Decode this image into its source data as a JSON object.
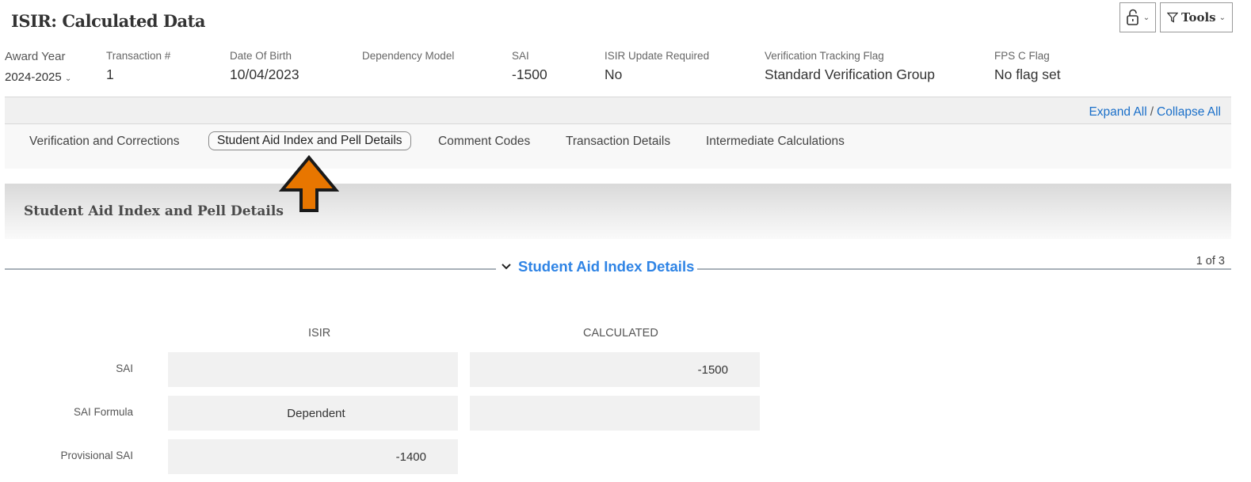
{
  "page": {
    "title": "ISIR: Calculated Data"
  },
  "toolbar": {
    "lock_icon": "unlock-icon",
    "tools_label": "Tools",
    "tools_icon": "filter-icon",
    "chevron": "⌄"
  },
  "summary": {
    "award_year": {
      "label": "Award Year",
      "value": "2024-2025"
    },
    "transaction": {
      "label": "Transaction #",
      "value": "1"
    },
    "dob": {
      "label": "Date Of Birth",
      "value": "10/04/2023"
    },
    "dependency_model": {
      "label": "Dependency Model",
      "value": ""
    },
    "sai": {
      "label": "SAI",
      "value": "-1500"
    },
    "isir_update": {
      "label": "ISIR Update Required",
      "value": "No"
    },
    "verification_flag": {
      "label": "Verification Tracking Flag",
      "value": "Standard Verification Group"
    },
    "fps_flag": {
      "label": "FPS C Flag",
      "value": "No flag set"
    }
  },
  "expand": {
    "expand_all": "Expand All",
    "separator": "/",
    "collapse_all": "Collapse All"
  },
  "tabs": [
    {
      "label": "Verification and Corrections",
      "active": false
    },
    {
      "label": "Student Aid Index and Pell Details",
      "active": true
    },
    {
      "label": "Comment Codes",
      "active": false
    },
    {
      "label": "Transaction Details",
      "active": false
    },
    {
      "label": "Intermediate Calculations",
      "active": false
    }
  ],
  "section": {
    "title": "Student Aid Index and Pell Details",
    "subsection_title": "Student Aid Index Details",
    "counter": "1 of 3"
  },
  "annotation": {
    "arrow_color": "#e87600"
  },
  "table": {
    "columns": [
      "ISIR",
      "CALCULATED"
    ],
    "rows": [
      {
        "label": "SAI",
        "isir": "",
        "calculated": "-1500"
      },
      {
        "label": "SAI Formula",
        "isir": "Dependent",
        "calculated": ""
      },
      {
        "label": "Provisional SAI",
        "isir": "-1400",
        "calculated": null
      }
    ]
  },
  "colors": {
    "link": "#1a6fc9",
    "section_link": "#2f84e5"
  }
}
